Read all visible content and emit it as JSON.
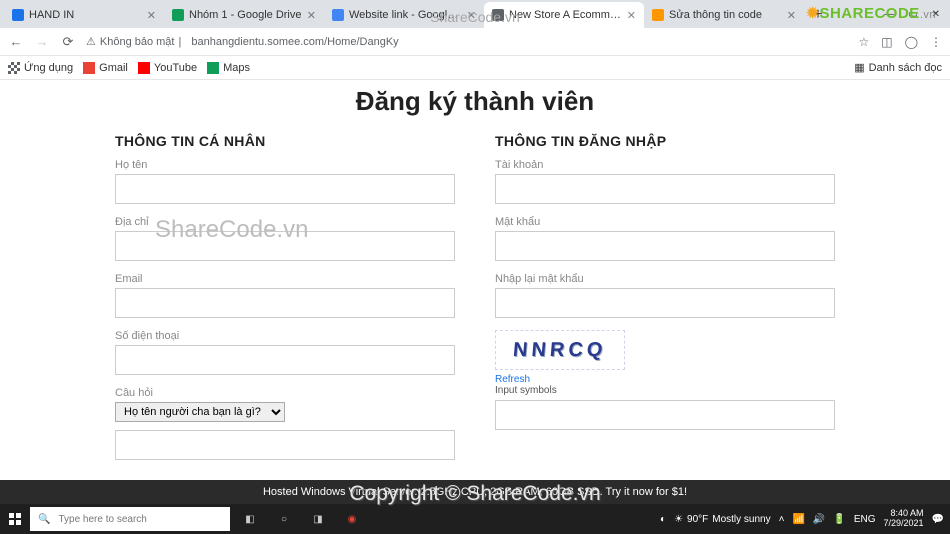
{
  "tabs": [
    {
      "label": "HAND IN",
      "active": false
    },
    {
      "label": "Nhóm 1 - Google Drive",
      "active": false
    },
    {
      "label": "Website link - Google Tài liệu",
      "active": false
    },
    {
      "label": "New Store A Ecommerce Catego",
      "active": true
    },
    {
      "label": "Sửa thông tin code",
      "active": false
    }
  ],
  "window_controls": {
    "min": "—",
    "max": "▭",
    "close": "✕"
  },
  "addrbar": {
    "security_text": "Không bảo mật",
    "url": "banhangdientu.somee.com/Home/DangKy"
  },
  "bookmarks": {
    "apps": "Ứng dụng",
    "items": [
      "Gmail",
      "YouTube",
      "Maps"
    ],
    "reading_list": "Danh sách đọc"
  },
  "page": {
    "title": "Đăng ký thành viên",
    "left_heading": "THÔNG TIN CÁ NHÂN",
    "right_heading": "THÔNG TIN ĐĂNG NHẬP",
    "labels": {
      "fullname": "Họ tên",
      "address": "Địa chỉ",
      "email": "Email",
      "phone": "Số điện thoại",
      "question": "Câu hỏi",
      "account": "Tài khoản",
      "password": "Mật khẩu",
      "repassword": "Nhập lại mật khẩu"
    },
    "question_select": "Họ tên người cha bạn là gì?",
    "captcha_text": "NNRCQ",
    "refresh": "Refresh",
    "captcha_hint": "Input symbols"
  },
  "watermarks": {
    "wm1": "ShareCode.vn",
    "center": "ShareCode.vn",
    "copyright": "Copyright © ShareCode.vn",
    "logo_main": "SHARECODE",
    "logo_suffix": ".vn"
  },
  "banner": "Hosted Windows Virtual Server. 2.5GHz CPU, 2GB RAM, 60GB SSD. Try it now for $1!",
  "taskbar": {
    "search_placeholder": "Type here to search",
    "weather_temp": "90°F",
    "weather_text": "Mostly sunny",
    "lang": "ENG",
    "time": "8:40 AM",
    "date": "7/29/2021"
  }
}
